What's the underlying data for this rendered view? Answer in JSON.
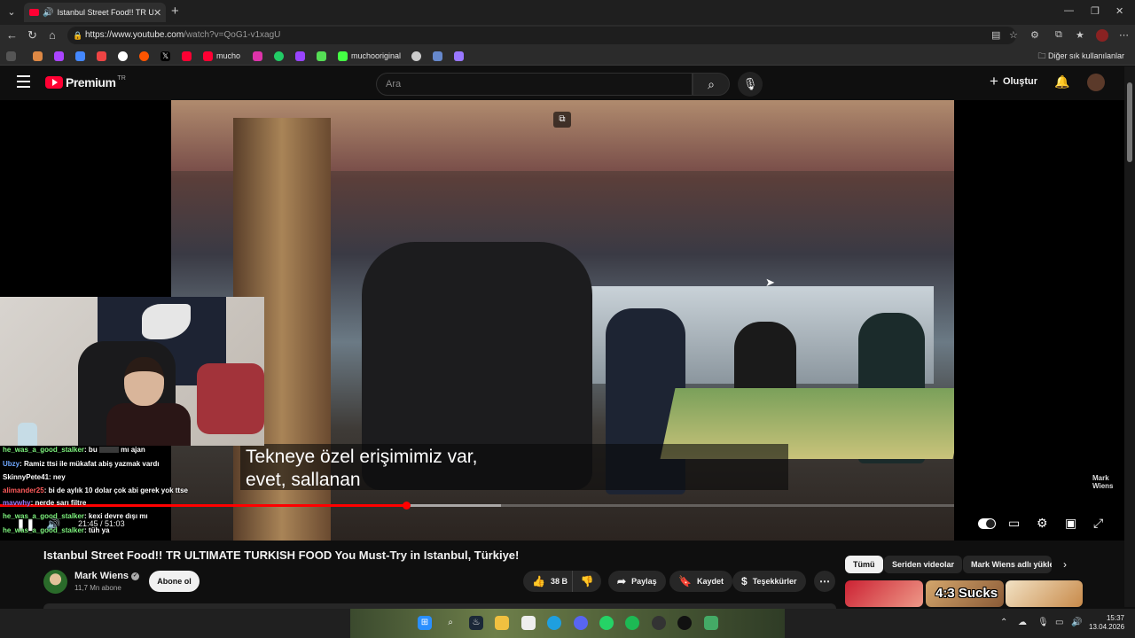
{
  "browser": {
    "tab_title": "Istanbul Street Food!! TR ULTIM",
    "url_host": "https://www.youtube.com",
    "url_path": "/watch?v=QoG1-v1xagU",
    "bookmarks": [
      "mucho",
      "muchooriginal"
    ],
    "other_bookmarks": "Diğer sık kullanılanlar"
  },
  "header": {
    "logo_word": "Premium",
    "country_code": "TR",
    "search_placeholder": "Ara",
    "create_label": "Oluştur"
  },
  "player": {
    "subtitle_line1": "Tekneye özel erişimimiz var,",
    "subtitle_line2": "evet, sallanan",
    "watermark_line1": "Mark",
    "watermark_line2": "Wiens",
    "current_time": "21:45",
    "duration": "51:03",
    "progress_fraction": 0.426,
    "buffered_fraction": 0.525
  },
  "chat": [
    {
      "user": "he_was_a_good_stalker",
      "color": "#7cf07c",
      "text": ": bu",
      "redacted": true,
      "after": "mı ajan"
    },
    {
      "user": "Ubzy",
      "color": "#6fa8ff",
      "text": ": Ramiz ttsi ile mükafat abiş yazmak vardı"
    },
    {
      "user": "SkinnyPete41",
      "color": "#ffffff",
      "text": ": ney"
    },
    {
      "user": "alimander25",
      "color": "#ff5b5b",
      "text": ": bi de aylık 10 dolar çok abi gerek yok ttse"
    },
    {
      "user": "mavwhy",
      "color": "#9b7bff",
      "text": ": nerde sarı filtre"
    },
    {
      "user": "he_was_a_good_stalker",
      "color": "#7cf07c",
      "text": ": kexi devre dışı mı"
    },
    {
      "user": "he_was_a_good_stalker",
      "color": "#7cf07c",
      "text": ": tüh ya"
    }
  ],
  "video": {
    "title": "Istanbul Street Food!! TR ULTIMATE TURKISH FOOD You Must-Try in Istanbul, Türkiye!",
    "channel": "Mark Wiens",
    "subscribers": "11,7 Mn abone",
    "subscribe_label": "Abone ol",
    "likes": "38 B",
    "share_label": "Paylaş",
    "save_label": "Kaydet",
    "thanks_label": "Teşekkürler"
  },
  "chips": [
    "Tümü",
    "Seriden videolar",
    "Mark Wiens adlı yükle"
  ],
  "thumbnail_text": "4:3 Sucks",
  "clock": {
    "time": "15:37",
    "date": "13.04.2026"
  },
  "colors": {
    "accent": "#ff0033",
    "background": "#0f0f0f"
  }
}
